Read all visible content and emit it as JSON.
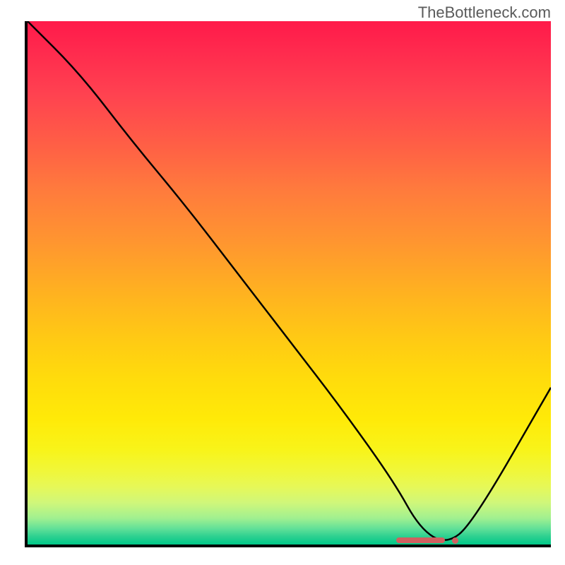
{
  "watermark": "TheBottleneck.com",
  "chart_data": {
    "type": "line",
    "title": "",
    "xlabel": "",
    "ylabel": "",
    "xlim": [
      0,
      100
    ],
    "ylim": [
      0,
      100
    ],
    "background_gradient": {
      "top_color": "#ff1a4a",
      "mid_color": "#ffdb0c",
      "bottom_color": "#00c888"
    },
    "series": [
      {
        "name": "bottleneck-curve",
        "x": [
          0,
          10,
          20,
          30,
          40,
          50,
          60,
          70,
          75,
          80,
          85,
          100
        ],
        "values": [
          100,
          90,
          77,
          65,
          52,
          39,
          26,
          12,
          3,
          0,
          4,
          30
        ]
      }
    ],
    "optimal_marker": {
      "x_start": 70,
      "x_end": 82,
      "color": "#d06060"
    }
  }
}
